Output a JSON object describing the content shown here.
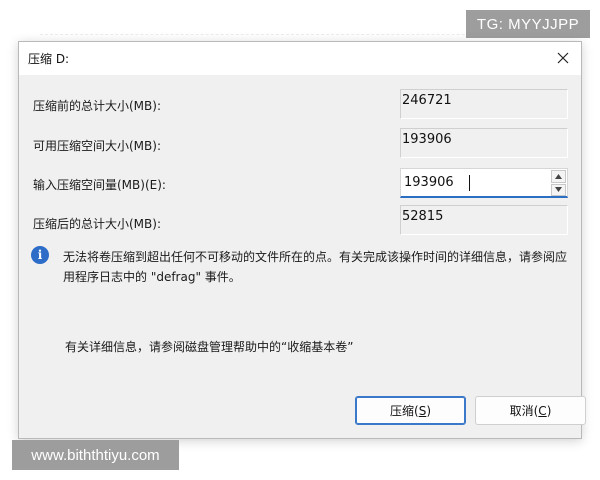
{
  "watermarks": {
    "top": "TG: MYYJJPP",
    "bottom": "www.biththtiyu.com"
  },
  "dialog": {
    "title": "压缩 D:",
    "fields": {
      "total_before": {
        "label": "压缩前的总计大小(MB):",
        "value": "246721"
      },
      "available": {
        "label": "可用压缩空间大小(MB):",
        "value": "193906"
      },
      "amount": {
        "label": "输入压缩空间量(MB)(E):",
        "value": "193906"
      },
      "total_after": {
        "label": "压缩后的总计大小(MB):",
        "value": "52815"
      }
    },
    "info_message": "无法将卷压缩到超出任何不可移动的文件所在的点。有关完成该操作时间的详细信息，请参阅应用程序日志中的 \"defrag\" 事件。",
    "help_message": "有关详细信息，请参阅磁盘管理帮助中的“收缩基本卷”",
    "buttons": {
      "shrink": {
        "text": "压缩(",
        "key": "S",
        "tail": ")"
      },
      "cancel": {
        "text": "取消(",
        "key": "C",
        "tail": ")"
      }
    },
    "icons": {
      "info": "info-icon",
      "close": "close-icon",
      "spin_up": "chevron-up-icon",
      "spin_down": "chevron-down-icon"
    },
    "colors": {
      "accent": "#2a6fc4",
      "info": "#2d6cc7",
      "dialog_bg": "#f0f0f0"
    }
  }
}
